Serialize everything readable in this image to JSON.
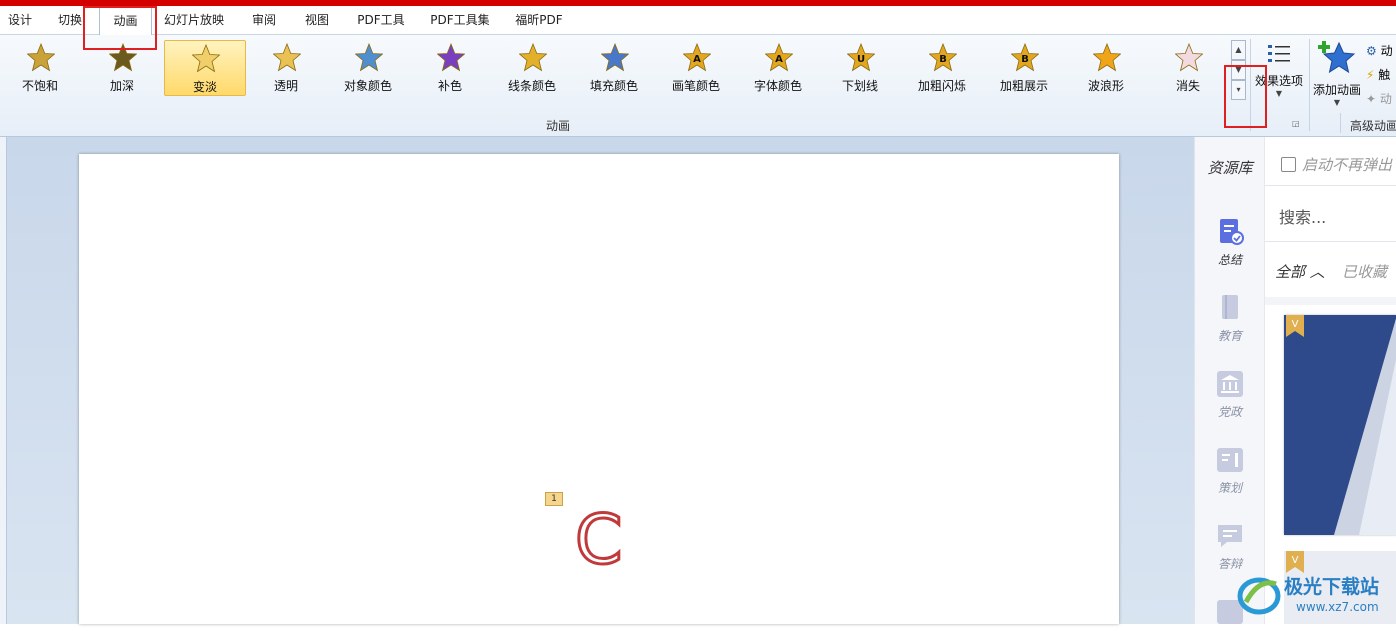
{
  "tabs": [
    "设计",
    "切换",
    "动画",
    "幻灯片放映",
    "审阅",
    "视图",
    "PDF工具",
    "PDF工具集",
    "福昕PDF"
  ],
  "active_tab": "动画",
  "effects": [
    {
      "label": "不饱和",
      "star": "#c9a23a",
      "badge": ""
    },
    {
      "label": "加深",
      "star": "#6b5a1e",
      "badge": ""
    },
    {
      "label": "变淡",
      "star": "#f0cf6a",
      "badge": "",
      "selected": true
    },
    {
      "label": "透明",
      "star": "#e9c253",
      "badge": ""
    },
    {
      "label": "对象颜色",
      "star": "#4f8fcf",
      "badge": ""
    },
    {
      "label": "补色",
      "star": "#7a3fbf",
      "badge": ""
    },
    {
      "label": "线条颜色",
      "star": "#e2b02a",
      "badge": ""
    },
    {
      "label": "填充颜色",
      "star": "#4a78c9",
      "badge": ""
    },
    {
      "label": "画笔颜色",
      "star": "#e3a71f",
      "badge": "A"
    },
    {
      "label": "字体颜色",
      "star": "#e3a71f",
      "badge": "A"
    },
    {
      "label": "下划线",
      "star": "#e3a71f",
      "badge": "U"
    },
    {
      "label": "加粗闪烁",
      "star": "#e3a71f",
      "badge": "B"
    },
    {
      "label": "加粗展示",
      "star": "#e3a71f",
      "badge": "B"
    },
    {
      "label": "波浪形",
      "star": "#f0a419",
      "badge": ""
    },
    {
      "label": "消失",
      "star": "#f3d9e0",
      "badge": ""
    }
  ],
  "ribbon": {
    "group_label": "动画",
    "effect_options": "效果选项",
    "add_animation": "添加动画",
    "adv_group_label": "高级动画",
    "adv_items": [
      "动",
      "触",
      "动"
    ]
  },
  "slide": {
    "anim_tag": "1",
    "text": "C"
  },
  "panel": {
    "title": "资源库",
    "startup_label": "启动不再弹出",
    "search_placeholder": "搜索...",
    "filter_all": "全部",
    "filter_fav": "已收藏",
    "nav": [
      "总结",
      "教育",
      "党政",
      "策划",
      "答辩"
    ]
  },
  "watermark": {
    "name": "极光下载站",
    "url": "www.xz7.com"
  },
  "colors": {
    "highlight_box": "#e02020",
    "accent_blue": "#2f4a8a",
    "nav_active": "#5b6fe0"
  }
}
